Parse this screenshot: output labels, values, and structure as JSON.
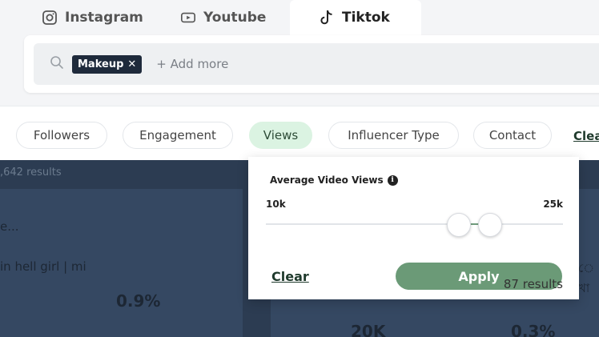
{
  "platform_tabs": [
    {
      "label": "Instagram",
      "icon": "instagram-icon",
      "active": false
    },
    {
      "label": "Youtube",
      "icon": "youtube-icon",
      "active": false
    },
    {
      "label": "Tiktok",
      "icon": "tiktok-icon",
      "active": true
    }
  ],
  "search": {
    "chips": [
      {
        "label": "Makeup",
        "remove": "✕"
      }
    ],
    "add_more": "+ Add more"
  },
  "filters": [
    {
      "label": "Followers",
      "active": false
    },
    {
      "label": "Engagement",
      "active": false
    },
    {
      "label": "Views",
      "active": true
    },
    {
      "label": "Influencer Type",
      "active": false
    },
    {
      "label": "Contact",
      "active": false
    }
  ],
  "clear_all": "Clea",
  "results": {
    "count": ",642 results",
    "left_card": {
      "line1": "e...",
      "line2": "in hell girl | mi",
      "stat": "0.9%"
    },
    "right_card": {
      "edge": "ে খা",
      "stat1": "20K",
      "stat2": "0.3%"
    }
  },
  "views_popover": {
    "title": "Average Video Views",
    "min_label": "10k",
    "max_label": "25k",
    "slider": {
      "low_fraction": 0.65,
      "high_fraction": 0.755
    },
    "clear": "Clear",
    "apply": "Apply",
    "result_count": "87 results"
  },
  "colors": {
    "accent": "#6b9a77",
    "active_pill": "#dbf3e2",
    "dark_bg": "#2c3c52",
    "chip_bg": "#1e2a3b"
  }
}
